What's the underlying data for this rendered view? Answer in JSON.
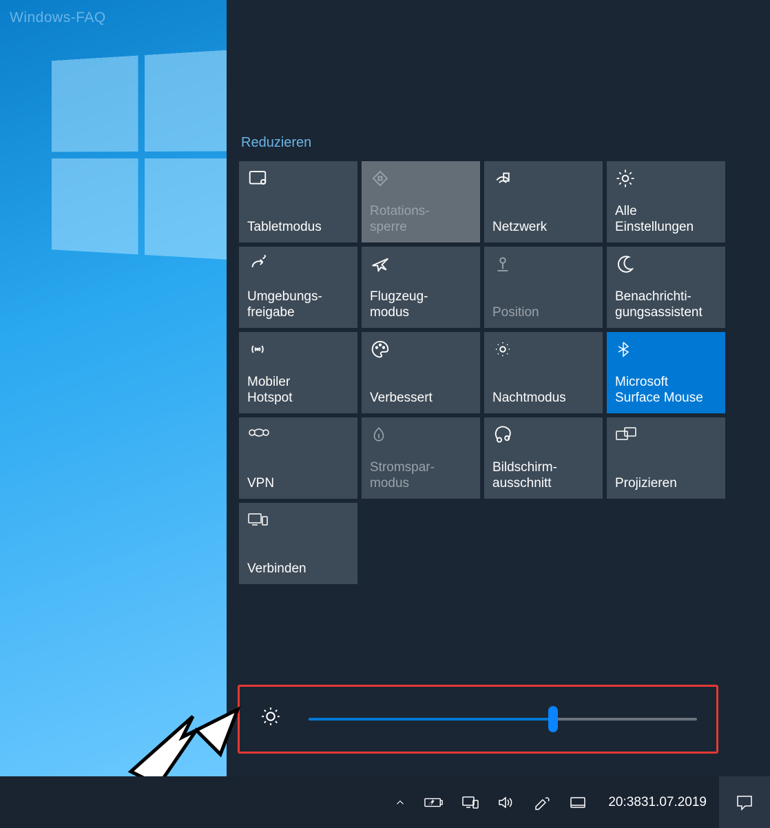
{
  "watermark": "Windows-FAQ",
  "collapse_label": "Reduzieren",
  "tiles": [
    {
      "label": "Tabletmodus",
      "icon": "tablet-icon"
    },
    {
      "label": "Rotations-\nsperre",
      "icon": "rotation-lock-icon"
    },
    {
      "label": "Netzwerk",
      "icon": "network-icon"
    },
    {
      "label": "Alle\nEinstellungen",
      "icon": "gear-icon"
    },
    {
      "label": "Umgebungs-\nfreigabe",
      "icon": "share-icon"
    },
    {
      "label": "Flugzeug-\nmodus",
      "icon": "airplane-icon"
    },
    {
      "label": "Position",
      "icon": "location-icon"
    },
    {
      "label": "Benachrichti-\ngungsassistent",
      "icon": "moon-icon"
    },
    {
      "label": "Mobiler\nHotspot",
      "icon": "hotspot-icon"
    },
    {
      "label": "Verbessert",
      "icon": "palette-icon"
    },
    {
      "label": "Nachtmodus",
      "icon": "sun-dim-icon"
    },
    {
      "label": "Microsoft\nSurface Mouse",
      "icon": "bluetooth-icon"
    },
    {
      "label": "VPN",
      "icon": "vpn-icon"
    },
    {
      "label": "Stromspar-\nmodus",
      "icon": "eco-icon"
    },
    {
      "label": "Bildschirm-\nausschnitt",
      "icon": "snip-icon"
    },
    {
      "label": "Projizieren",
      "icon": "project-icon"
    },
    {
      "label": "Verbinden",
      "icon": "connect-icon"
    }
  ],
  "brightness": {
    "percent": 63
  },
  "taskbar": {
    "time": "20:38",
    "date": "31.07.2019"
  }
}
